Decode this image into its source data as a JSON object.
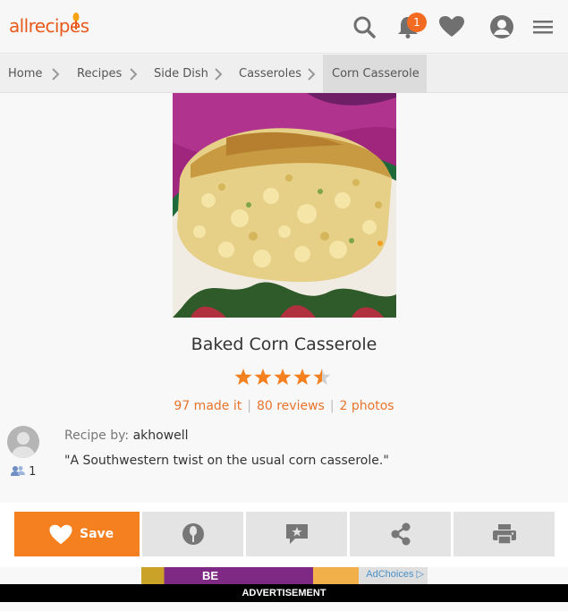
{
  "header": {
    "logo": "allrecipes",
    "notification_count": "1",
    "icons": [
      "search-icon",
      "bell-icon",
      "heart-icon",
      "user-icon",
      "menu-icon"
    ],
    "brand_color": "#e8591c",
    "badge_color": "#f26b21"
  },
  "breadcrumb": {
    "items": [
      {
        "label": "Home"
      },
      {
        "label": "Recipes"
      },
      {
        "label": "Side Dish"
      },
      {
        "label": "Casseroles"
      },
      {
        "label": "Corn Casserole"
      }
    ]
  },
  "recipe": {
    "title": "Baked Corn Casserole",
    "rating": 4.5,
    "rating_max": 5,
    "made_it": "97 made it",
    "reviews": "80 reviews",
    "photos": "2 photos",
    "accent_color": "#e8742c",
    "star_color": "#f58020"
  },
  "author": {
    "label": "Recipe by:",
    "name": "akhowell",
    "followers": "1",
    "description": "\"A Southwestern twist on the usual corn casserole.\""
  },
  "actions": {
    "save_label": "Save",
    "buttons": [
      "made-it-icon",
      "review-icon",
      "share-icon",
      "print-icon"
    ]
  },
  "ad": {
    "choices": "AdChoices",
    "banner_text": "BE",
    "label": "ADVERTISEMENT"
  }
}
